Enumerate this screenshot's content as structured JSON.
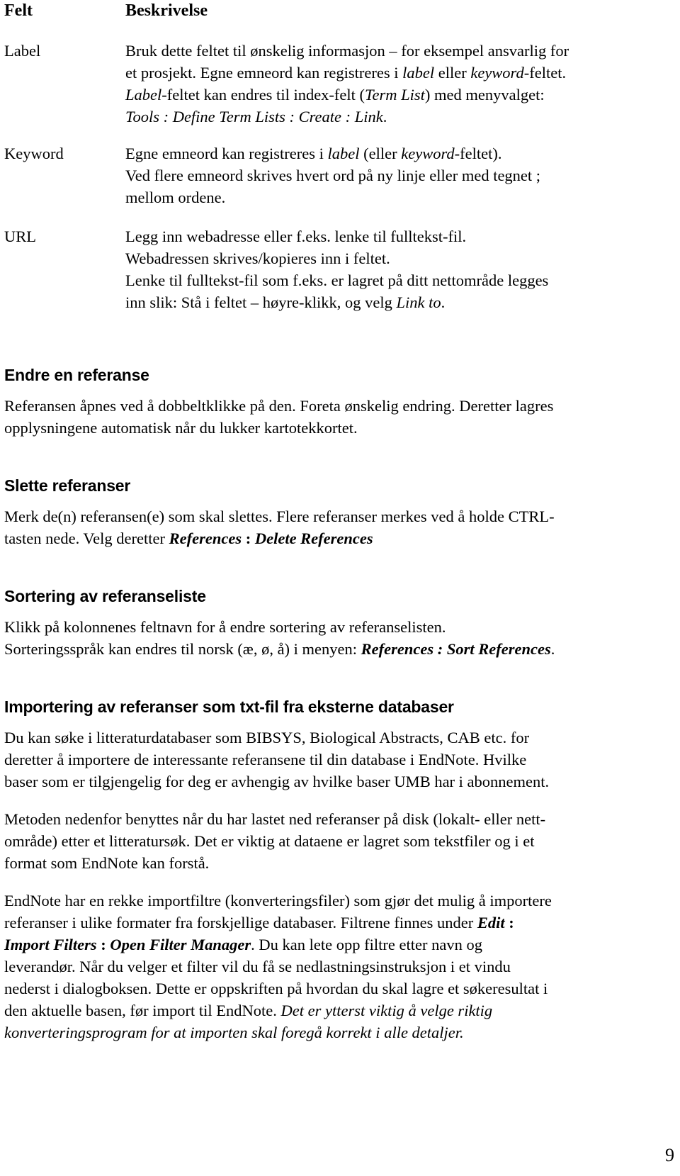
{
  "table": {
    "headers": {
      "field": "Felt",
      "description": "Beskrivelse"
    },
    "rows": [
      {
        "field": "Label",
        "lines": [
          [
            {
              "t": "Bruk dette feltet til ønskelig informasjon – for eksempel ansvarlig for"
            }
          ],
          [
            {
              "t": "et prosjekt. Egne emneord kan registreres i "
            },
            {
              "t": "label",
              "s": "i"
            },
            {
              "t": " eller "
            },
            {
              "t": "keyword",
              "s": "i"
            },
            {
              "t": "-feltet."
            }
          ],
          [
            {
              "t": "Label",
              "s": "i"
            },
            {
              "t": "-feltet kan endres til index-felt ("
            },
            {
              "t": "Term List",
              "s": "i"
            },
            {
              "t": ") med menyvalget:"
            }
          ],
          [
            {
              "t": "Tools : Define Term Lists : Create : Link",
              "s": "i"
            },
            {
              "t": "."
            }
          ]
        ]
      },
      {
        "field": "Keyword",
        "lines": [
          [
            {
              "t": "Egne emneord kan registreres i "
            },
            {
              "t": "label",
              "s": "i"
            },
            {
              "t": " (eller "
            },
            {
              "t": "keyword",
              "s": "i"
            },
            {
              "t": "-feltet)."
            }
          ],
          [
            {
              "t": "Ved flere emneord skrives hvert ord på ny linje eller med tegnet ;"
            }
          ],
          [
            {
              "t": "mellom ordene."
            }
          ]
        ]
      },
      {
        "field": "URL",
        "lines": [
          [
            {
              "t": "Legg inn webadresse eller f.eks. lenke til fulltekst-fil."
            }
          ],
          [
            {
              "t": "Webadressen skrives/kopieres inn i feltet."
            }
          ],
          [
            {
              "t": "Lenke til fulltekst-fil som f.eks. er lagret på ditt nettområde legges"
            }
          ],
          [
            {
              "t": "inn slik: Stå i feltet – høyre-klikk, og velg "
            },
            {
              "t": "Link to",
              "s": "i"
            },
            {
              "t": "."
            }
          ]
        ]
      }
    ]
  },
  "sections": [
    {
      "heading": "Endre en referanse",
      "paragraphs": [
        [
          [
            {
              "t": "Referansen åpnes ved å dobbeltklikke på den. Foreta ønskelig endring. Deretter lagres"
            }
          ],
          [
            {
              "t": "opplysningene automatisk når du lukker kartotekkortet."
            }
          ]
        ]
      ]
    },
    {
      "heading": "Slette referanser",
      "paragraphs": [
        [
          [
            {
              "t": "Merk de(n) referansen(e) som skal slettes. Flere referanser merkes ved å holde CTRL-"
            }
          ],
          [
            {
              "t": "tasten nede. Velg deretter "
            },
            {
              "t": "References",
              "s": "bi"
            },
            {
              "t": " : ",
              "s": "b"
            },
            {
              "t": "Delete References",
              "s": "bi"
            }
          ]
        ]
      ]
    },
    {
      "heading": "Sortering av referanseliste",
      "paragraphs": [
        [
          [
            {
              "t": "Klikk på kolonnenes feltnavn for å endre sortering av referanselisten."
            }
          ],
          [
            {
              "t": "Sorteringsspråk kan endres til norsk (æ, ø, å) i menyen: "
            },
            {
              "t": "References : Sort References",
              "s": "bi"
            },
            {
              "t": "."
            }
          ]
        ]
      ]
    },
    {
      "heading": "Importering av referanser som txt-fil fra eksterne databaser",
      "paragraphs": [
        [
          [
            {
              "t": "Du kan søke i litteraturdatabaser som BIBSYS, Biological Abstracts, CAB etc. for"
            }
          ],
          [
            {
              "t": "deretter å importere de interessante referansene til din database i EndNote. Hvilke"
            }
          ],
          [
            {
              "t": "baser som er tilgjengelig for deg er avhengig av hvilke baser UMB har i abonnement."
            }
          ]
        ],
        [
          [
            {
              "t": "Metoden nedenfor benyttes når du har lastet ned referanser på disk (lokalt- eller nett-"
            }
          ],
          [
            {
              "t": "område) etter et litteratursøk. Det er viktig at dataene er lagret som tekstfiler og i et"
            }
          ],
          [
            {
              "t": "format som EndNote kan forstå."
            }
          ]
        ],
        [
          [
            {
              "t": "EndNote har en rekke importfiltre (konverteringsfiler) som gjør det mulig å importere"
            }
          ],
          [
            {
              "t": "referanser i ulike formater fra forskjellige databaser. Filtrene finnes under "
            },
            {
              "t": "Edit",
              "s": "bi"
            },
            {
              "t": " :",
              "s": "b"
            }
          ],
          [
            {
              "t": "Import Filters",
              "s": "bi"
            },
            {
              "t": " : ",
              "s": "b"
            },
            {
              "t": "Open Filter Manager",
              "s": "bi"
            },
            {
              "t": ". Du kan lete opp filtre etter navn og"
            }
          ],
          [
            {
              "t": "leverandør.  Når du velger et filter vil du få se nedlastningsinstruksjon i et vindu"
            }
          ],
          [
            {
              "t": "nederst i dialogboksen. Dette er oppskriften på hvordan du skal lagre et søkeresultat i"
            }
          ],
          [
            {
              "t": "den aktuelle basen, før import til EndNote. "
            },
            {
              "t": "Det er ytterst viktig å velge riktig",
              "s": "i"
            }
          ],
          [
            {
              "t": "konverteringsprogram for at importen skal foregå korrekt i alle detaljer.",
              "s": "i"
            }
          ]
        ]
      ]
    }
  ],
  "page_number": "9"
}
